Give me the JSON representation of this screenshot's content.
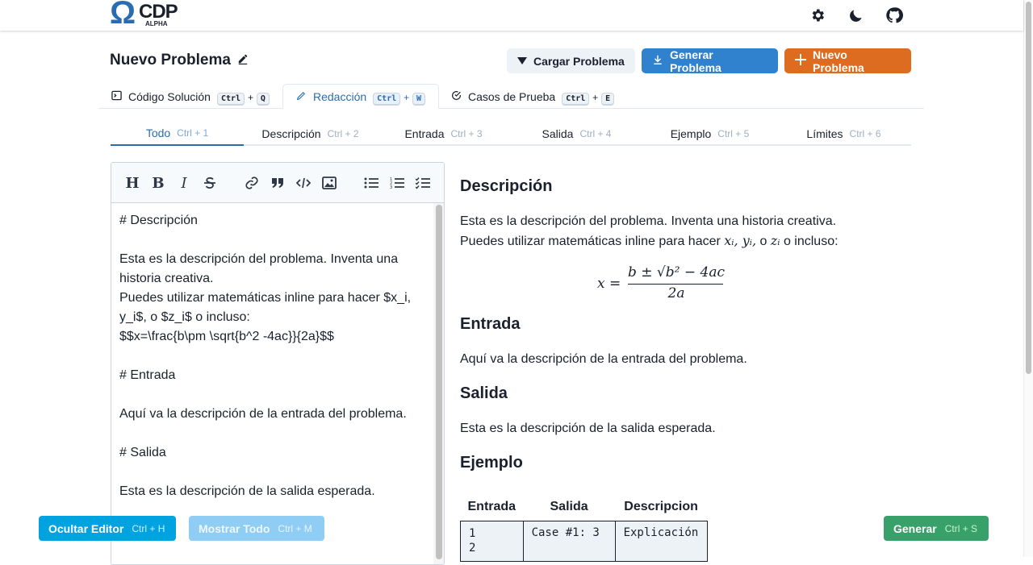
{
  "header": {
    "logo_symbol": "Ω",
    "logo_name": "CDP",
    "logo_sub": "ALPHA",
    "icons": [
      "gear-icon",
      "moon-icon",
      "github-icon"
    ]
  },
  "page": {
    "title": "Nuevo Problema",
    "buttons": {
      "load": "Cargar Problema",
      "generate": "Generar Problema",
      "new": "Nuevo Problema"
    }
  },
  "tabs": [
    {
      "label": "Código Solución",
      "key1": "Ctrl",
      "key2": "Q"
    },
    {
      "label": "Redacción",
      "key1": "Ctrl",
      "key2": "W"
    },
    {
      "label": "Casos de Prueba",
      "key1": "Ctrl",
      "key2": "E"
    }
  ],
  "plus": "+",
  "subtabs": [
    {
      "label": "Todo",
      "shortcut": "Ctrl + 1"
    },
    {
      "label": "Descripción",
      "shortcut": "Ctrl + 2"
    },
    {
      "label": "Entrada",
      "shortcut": "Ctrl + 3"
    },
    {
      "label": "Salida",
      "shortcut": "Ctrl + 4"
    },
    {
      "label": "Ejemplo",
      "shortcut": "Ctrl + 5"
    },
    {
      "label": "Límites",
      "shortcut": "Ctrl + 6"
    }
  ],
  "editor": {
    "toolbar": [
      "heading",
      "bold",
      "italic",
      "strikethrough",
      "link",
      "quote",
      "code",
      "image",
      "bulleted-list",
      "numbered-list",
      "task-list"
    ],
    "lines": [
      "# Descripción",
      "",
      "Esta es la descripción del problema. Inventa una",
      "historia creativa.",
      "Puedes utilizar matemáticas inline para hacer $x_i,",
      "y_i$, o $z_i$ o incluso:",
      "$$x=\\frac{b\\pm \\sqrt{b^2 -4ac}}{2a}$$",
      "",
      "# Entrada",
      "",
      "Aquí va la descripción de la entrada del problema.",
      "",
      "# Salida",
      "",
      "Esta es la descripción de la salida esperada."
    ]
  },
  "preview": {
    "desc_heading": "Descripción",
    "desc_p1": "Esta es la descripción del problema. Inventa una historia creativa.",
    "desc_p2_pre": "Puedes utilizar matemáticas inline para hacer ",
    "desc_p2_math1": "xᵢ, yᵢ,",
    "desc_p2_mid": " o ",
    "desc_p2_math2": "zᵢ",
    "desc_p2_post": " o incluso:",
    "formula": {
      "lhs": "x =",
      "numerator": "b ± √b² − 4ac",
      "denominator": "2a"
    },
    "input_heading": "Entrada",
    "input_text": "Aquí va la descripción de la entrada del problema.",
    "output_heading": "Salida",
    "output_text": "Esta es la descripción de la salida esperada.",
    "example_heading": "Ejemplo",
    "table": {
      "headers": [
        "Entrada",
        "Salida",
        "Descripcion"
      ],
      "row": [
        "1\n2",
        "Case #1: 3",
        "Explicación"
      ]
    }
  },
  "footer": {
    "hide_editor": "Ocultar Editor",
    "hide_shortcut": "Ctrl + H",
    "show_all": "Mostrar Todo",
    "show_shortcut": "Ctrl + M",
    "generate": "Generar",
    "generate_shortcut": "Ctrl + S"
  }
}
